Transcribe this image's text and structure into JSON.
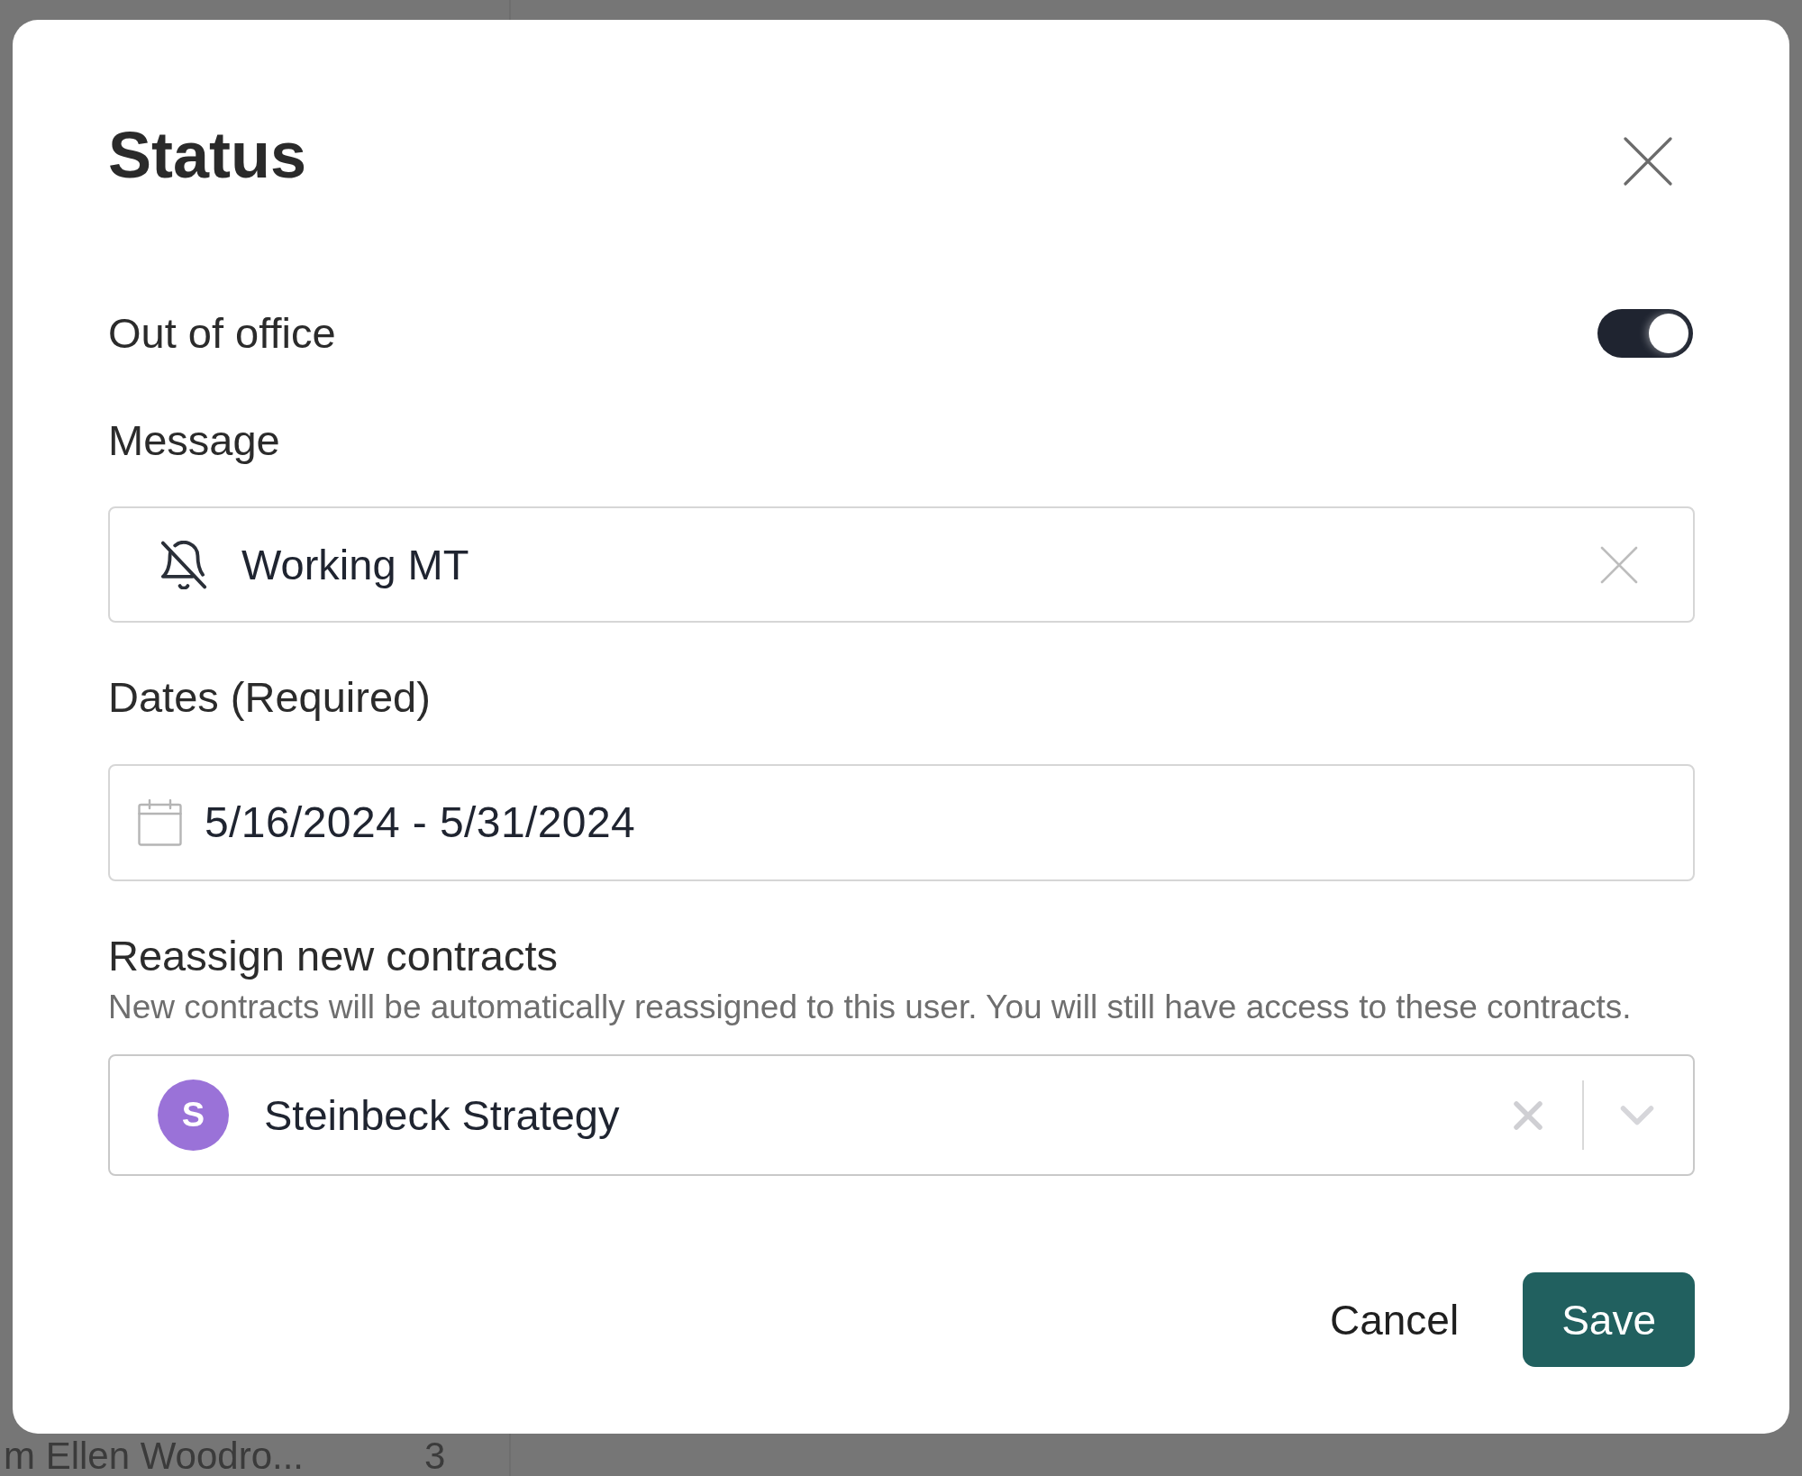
{
  "background_row": {
    "name": "m Ellen Woodro...",
    "count": "3"
  },
  "dialog": {
    "title": "Status"
  },
  "out_of_office": {
    "label": "Out of office",
    "on": true
  },
  "message": {
    "label": "Message",
    "value": "Working MT"
  },
  "dates": {
    "label": "Dates (Required)",
    "value": "5/16/2024 - 5/31/2024"
  },
  "reassign": {
    "label": "Reassign new contracts",
    "description": "New contracts will be automatically reassigned to this user. You will still have access to these contracts.",
    "avatar_initial": "S",
    "value": "Steinbeck Strategy"
  },
  "buttons": [
    {
      "label": "Cancel",
      "kind": "secondary"
    },
    {
      "label": "Save",
      "kind": "primary"
    }
  ]
}
